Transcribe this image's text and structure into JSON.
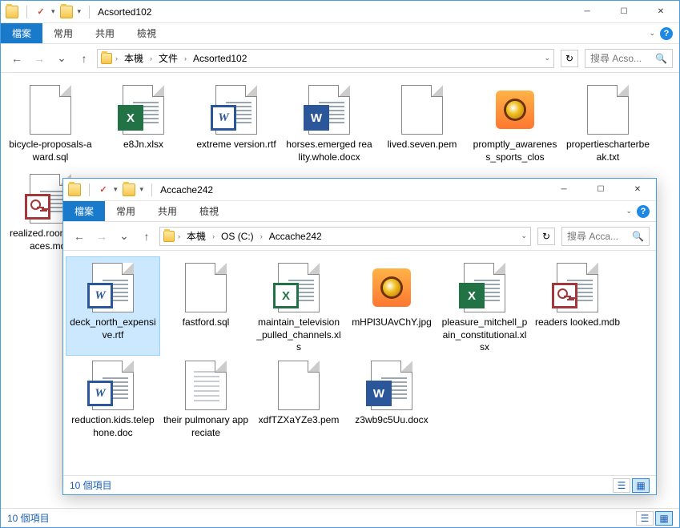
{
  "w1": {
    "title": "Acsorted102",
    "tabs": {
      "file": "檔案",
      "home": "常用",
      "share": "共用",
      "view": "檢視"
    },
    "crumbs": [
      "本機",
      "文件",
      "Acsorted102"
    ],
    "search": "搜尋 Acso...",
    "status": "10 個項目",
    "items": [
      {
        "name": "bicycle-proposals-award.sql",
        "type": "blank"
      },
      {
        "name": "e8Jn.xlsx",
        "type": "xlsx"
      },
      {
        "name": "extreme version.rtf",
        "type": "rtf"
      },
      {
        "name": "horses.emerged reality.whole.docx",
        "type": "docx"
      },
      {
        "name": "lived.seven.pem",
        "type": "blank"
      },
      {
        "name": "promptly_awareness_sports_clos",
        "type": "jpg"
      },
      {
        "name": "propertiescharterbeak.txt",
        "type": "blank"
      },
      {
        "name": "realized.rooms.surfaces.mdb",
        "type": "mdb"
      }
    ]
  },
  "w2": {
    "title": "Accache242",
    "tabs": {
      "file": "檔案",
      "home": "常用",
      "share": "共用",
      "view": "檢視"
    },
    "crumbs": [
      "本機",
      "OS (C:)",
      "Accache242"
    ],
    "search": "搜尋 Acca...",
    "status": "10 個項目",
    "items": [
      {
        "name": "deck_north_expensive.rtf",
        "type": "rtf",
        "selected": true
      },
      {
        "name": "fastford.sql",
        "type": "blank"
      },
      {
        "name": "maintain_television_pulled_channels.xls",
        "type": "xls"
      },
      {
        "name": "mHPl3UAvChY.jpg",
        "type": "jpg"
      },
      {
        "name": "pleasure_mitchell_pain_constitutional.xlsx",
        "type": "xlsx"
      },
      {
        "name": "readers looked.mdb",
        "type": "mdb"
      },
      {
        "name": "reduction.kids.telephone.doc",
        "type": "doc"
      },
      {
        "name": "their pulmonary appreciate",
        "type": "text"
      },
      {
        "name": "xdfTZXaYZe3.pem",
        "type": "blank"
      },
      {
        "name": "z3wb9c5Uu.docx",
        "type": "docx"
      }
    ]
  }
}
